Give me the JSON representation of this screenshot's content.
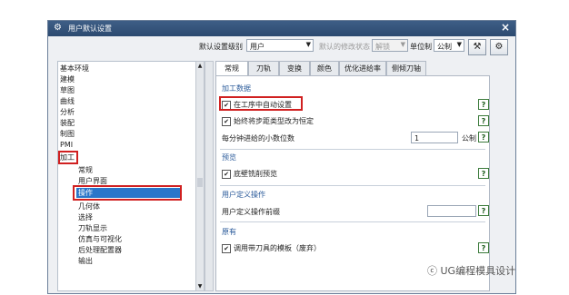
{
  "window": {
    "title": "用户默认设置",
    "close": "×"
  },
  "toolbar": {
    "level_label": "默认设置级别",
    "level_value": "用户",
    "status_label": "默认的修改状态",
    "status_value": "解锁",
    "unit_label": "单位制",
    "unit_value": "公制"
  },
  "tree": {
    "items": [
      "基本环境",
      "建模",
      "草图",
      "曲线",
      "分析",
      "装配",
      "制图",
      "PMI",
      "加工"
    ],
    "children": [
      "常规",
      "用户界面",
      "操作",
      "几何体",
      "选择",
      "刀轨显示",
      "仿真与可视化",
      "后处理配置器",
      "输出"
    ]
  },
  "tabs": [
    "常规",
    "刀轨",
    "变换",
    "颜色",
    "优化进给率",
    "侧倾刀轴"
  ],
  "panel": {
    "sec1": "加工数据",
    "opt1": "在工序中自动设置",
    "opt2": "始终将步距类型改为恒定",
    "decimal_label": "每分钟进给的小数位数",
    "decimal_value": "1",
    "decimal_unit": "公制",
    "sec2": "预览",
    "opt3": "底壁铣削预览",
    "sec3": "用户定义操作",
    "udo_label": "用户定义操作前缀",
    "udo_value": "",
    "sec4": "原有",
    "opt4": "调用带刀具的模板（废弃）",
    "check": "✔",
    "help": "?"
  },
  "watermark": "UG编程模具设计"
}
